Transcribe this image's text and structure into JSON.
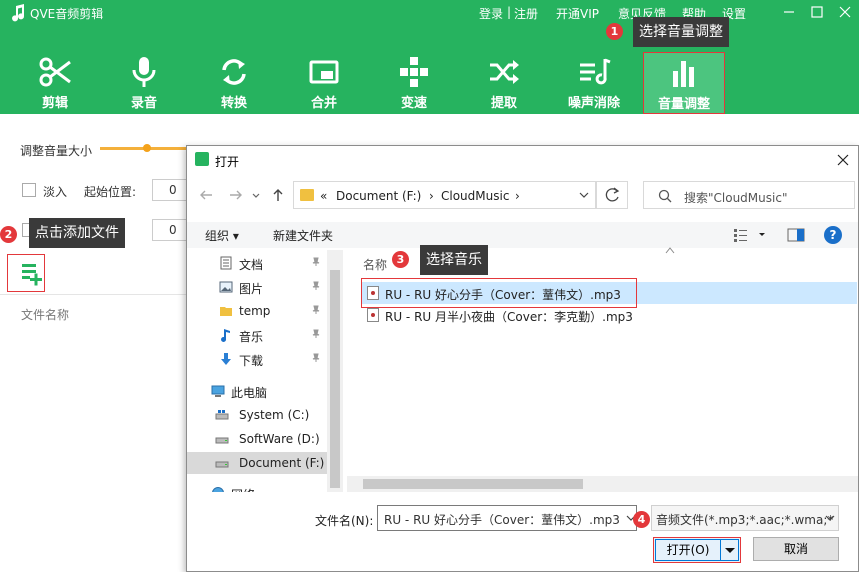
{
  "app": {
    "title": "QVE音频剪辑",
    "links": [
      "登录",
      "|",
      "注册",
      "开通VIP",
      "意见反馈",
      "帮助",
      "设置"
    ]
  },
  "toolbar": [
    {
      "label": "剪辑",
      "icon": "scissors-icon"
    },
    {
      "label": "录音",
      "icon": "microphone-icon"
    },
    {
      "label": "转换",
      "icon": "convert-icon"
    },
    {
      "label": "合并",
      "icon": "merge-icon"
    },
    {
      "label": "变速",
      "icon": "speed-icon"
    },
    {
      "label": "提取",
      "icon": "shuffle-icon"
    },
    {
      "label": "噪声消除",
      "icon": "noise-icon"
    },
    {
      "label": "音量调整",
      "icon": "volume-bars-icon",
      "active": true
    }
  ],
  "callouts": [
    {
      "num": "1",
      "text": "选择音量调整"
    },
    {
      "num": "2",
      "text": "点击添加文件"
    },
    {
      "num": "3",
      "text": "选择音乐"
    },
    {
      "num": "4",
      "text": ""
    }
  ],
  "panel": {
    "volume_label": "调整音量大小",
    "volume_level": 0.55,
    "fade_in": "淡入",
    "start_label": "起始位置:",
    "start_value": "0",
    "second_value": "0",
    "filename_col": "文件名称"
  },
  "dialog": {
    "title": "打开",
    "path": [
      "«",
      "Document (F:)",
      "›",
      "CloudMusic",
      "›"
    ],
    "search_placeholder": "搜索\"CloudMusic\"",
    "organize": "组织 ▾",
    "new_folder": "新建文件夹",
    "help": "?",
    "nav": [
      {
        "label": "文档",
        "icon": "document-icon",
        "pinned": true
      },
      {
        "label": "图片",
        "icon": "picture-icon",
        "pinned": true
      },
      {
        "label": "temp",
        "icon": "folder-icon",
        "pinned": true
      },
      {
        "label": "音乐",
        "icon": "music-icon",
        "pinned": true
      },
      {
        "label": "下载",
        "icon": "download-icon",
        "pinned": true
      },
      {
        "label": "此电脑",
        "icon": "computer-icon"
      },
      {
        "label": "System (C:)",
        "icon": "drive-icon"
      },
      {
        "label": "SoftWare (D:)",
        "icon": "drive-icon"
      },
      {
        "label": "Document (F:)",
        "icon": "drive-icon",
        "selected": true
      },
      {
        "label": "网络",
        "icon": "network-icon"
      }
    ],
    "list_header": "名称",
    "files": [
      {
        "name": "RU - RU 好心分手（Cover：蕫伟文）.mp3",
        "selected": true
      },
      {
        "name": "RU - RU 月半小夜曲（Cover：李克勤）.mp3"
      }
    ],
    "filename_label": "文件名(N):",
    "filename_value": "RU - RU 好心分手（Cover：蕫伟文）.mp3",
    "filetype": "音频文件(*.mp3;*.aac;*.wma;*",
    "open": "打开(O)",
    "cancel": "取消"
  },
  "colors": {
    "brand_green": "#26b35f",
    "callout_red": "#e3383b",
    "slider_orange": "#f4b03b"
  }
}
